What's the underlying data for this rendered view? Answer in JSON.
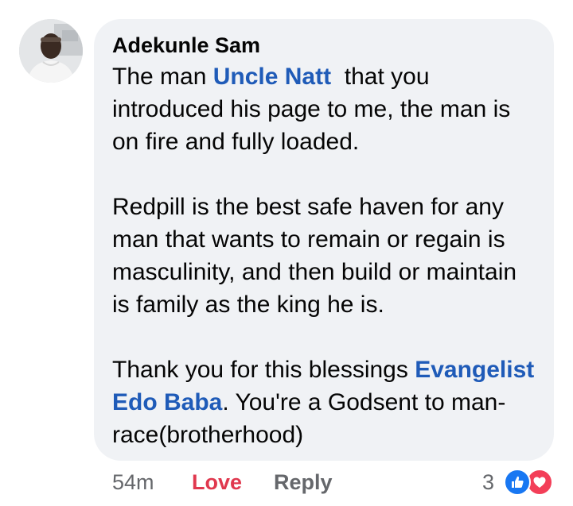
{
  "comment": {
    "author": "Adekunle Sam",
    "paragraphs": [
      {
        "p1_pre": "The man ",
        "p1_mention": "Uncle Natt",
        "p1_post": "  that you introduced his page to me, the man is on fire and fully loaded."
      },
      {
        "text": "Redpill is the best safe haven for any man that wants to remain or regain is masculinity, and then build or maintain is family as the king he is."
      },
      {
        "p3_pre": "Thank you for this blessings ",
        "p3_mention": "Evangelist Edo Baba",
        "p3_post": ". You're a Godsent to man-race(brotherhood)"
      }
    ]
  },
  "actions": {
    "time": "54m",
    "love_label": "Love",
    "reply_label": "Reply",
    "reaction_count": "3"
  },
  "reactions": {
    "icons": [
      "like-icon",
      "love-icon"
    ],
    "like_color": "#1877f2",
    "love_color": "#f33e58"
  },
  "colors": {
    "bubble": "#f0f2f5",
    "mention": "#1f5bb8",
    "love_active": "#e0384e",
    "muted": "#65676b"
  }
}
